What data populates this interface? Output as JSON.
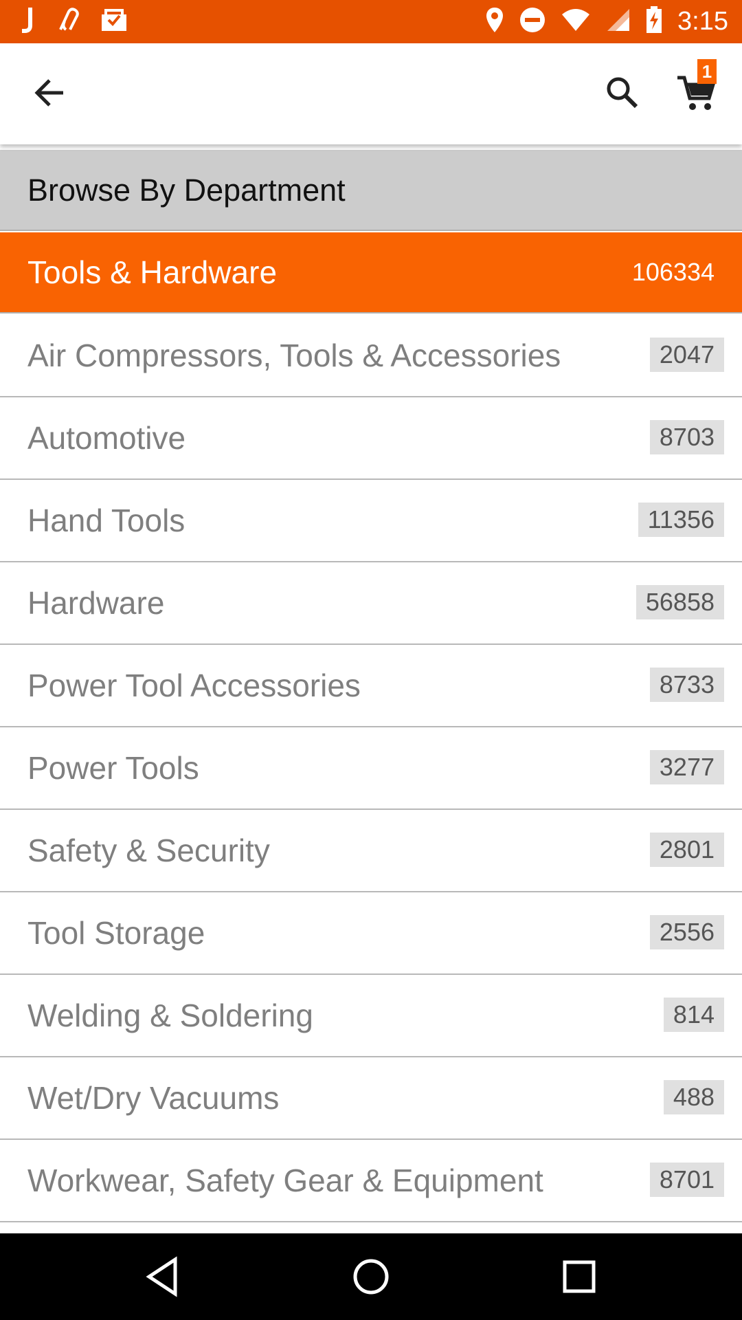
{
  "status_bar": {
    "time": "3:15",
    "left_icons": [
      "j-app-icon",
      "link-app-icon",
      "mail-check-icon"
    ],
    "right_icons": [
      "location-icon",
      "do-not-disturb-icon",
      "wifi-icon",
      "signal-icon",
      "battery-charging-icon"
    ]
  },
  "app_bar": {
    "back_icon": "arrow-back-icon",
    "search_icon": "search-icon",
    "cart_icon": "cart-icon",
    "cart_count": "1"
  },
  "header": {
    "title": "Browse By Department"
  },
  "department": {
    "name": "Tools & Hardware",
    "count": "106334",
    "accent": "#f96302"
  },
  "categories": [
    {
      "label": "Air Compressors, Tools & Accessories",
      "count": "2047"
    },
    {
      "label": "Automotive",
      "count": "8703"
    },
    {
      "label": "Hand Tools",
      "count": "11356"
    },
    {
      "label": "Hardware",
      "count": "56858"
    },
    {
      "label": "Power Tool Accessories",
      "count": "8733"
    },
    {
      "label": "Power Tools",
      "count": "3277"
    },
    {
      "label": "Safety & Security",
      "count": "2801"
    },
    {
      "label": "Tool Storage",
      "count": "2556"
    },
    {
      "label": "Welding & Soldering",
      "count": "814"
    },
    {
      "label": "Wet/Dry Vacuums",
      "count": "488"
    },
    {
      "label": "Workwear, Safety Gear & Equipment",
      "count": "8701"
    }
  ],
  "nav_bar": [
    "back-triangle-icon",
    "home-circle-icon",
    "recents-square-icon"
  ],
  "colors": {
    "status_bar": "#e65100",
    "accent": "#f96302",
    "header_bg": "#cccccc"
  }
}
